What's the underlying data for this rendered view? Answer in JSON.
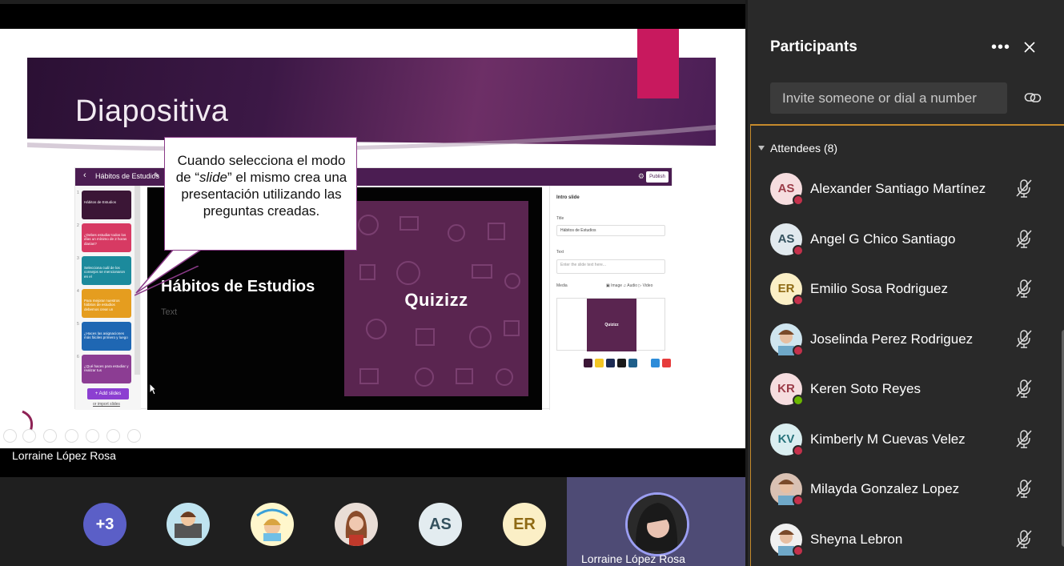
{
  "slide": {
    "title": "Diapositiva",
    "callout_parts": [
      "Cuando selecciona el modo de “",
      "slide",
      "” el mismo crea una presentación utilizando las preguntas creadas."
    ]
  },
  "editor": {
    "back": "‹",
    "title": "Hábitos de Estudios",
    "publish": "Publish",
    "thumbnails": [
      {
        "num": "1",
        "text": "Hábitos de Estudios",
        "color": "#3b1636"
      },
      {
        "num": "2",
        "text": "¿Debes estudiar todos los días un mínimo de 2 horas diarias?",
        "color": "#d73a63"
      },
      {
        "num": "3",
        "text": "Selecciona cuál de los consejos se mencionaron en el",
        "color": "#1c8a9c"
      },
      {
        "num": "4",
        "text": "Para mejorar nuestros hábitos de estudios debemos crear un",
        "color": "#e59d1f"
      },
      {
        "num": "5",
        "text": "¿Haces las asignaciones más fáciles primero y luego",
        "color": "#1f67b3"
      },
      {
        "num": "6",
        "text": "¿Qué haces para estudiar y realizar tus",
        "color": "#8c3d93"
      }
    ],
    "add_slides": "+ Add slides",
    "import_slides": "or import slides",
    "stage_title": "Hábitos de Estudios",
    "stage_text": "Text",
    "logo": "Quizizz",
    "right_panel": {
      "heading": "Intro slide",
      "title_label": "Title",
      "title_value": "Hábitos de Estudios",
      "text_label": "Text",
      "text_placeholder": "Enter the slide text here...",
      "media_label": "Media",
      "media_tabs": "▣ Image  ♫ Audio  ▷ Video",
      "media_logo": "Quizizz",
      "swatches": [
        "#3b1636",
        "#f3c624",
        "#1d2c54",
        "#1a1a1a",
        "#1f5f8a",
        "#ffffff",
        "#2d8cd9",
        "#e63c3c"
      ]
    }
  },
  "presenter": {
    "name": "Lorraine López Rosa"
  },
  "gallery": {
    "more": "+3",
    "initials_as": "AS",
    "initials_er": "ER",
    "speaker_name": "Lorraine López Rosa"
  },
  "panel": {
    "title": "Participants",
    "more": "•••",
    "invite_placeholder": "Invite someone or dial a number",
    "attendees_label": "Attendees (8)",
    "attendees": [
      {
        "name": "Alexander Santiago Martínez",
        "initials": "AS",
        "bg": "#f6dddf",
        "fg": "#9b3b47",
        "status": "busy"
      },
      {
        "name": "Angel G Chico Santiago",
        "initials": "AS",
        "bg": "#e1e9ee",
        "fg": "#34515e",
        "status": "busy"
      },
      {
        "name": "Emilio Sosa Rodriguez",
        "initials": "ER",
        "bg": "#fbefc6",
        "fg": "#8f6a14",
        "status": "busy"
      },
      {
        "name": "Joselinda Perez Rodriguez",
        "initials": "",
        "bg": "#cfe5ef",
        "fg": "#333333",
        "status": "busy"
      },
      {
        "name": "Keren Soto Reyes",
        "initials": "KR",
        "bg": "#f6dddf",
        "fg": "#9b3b47",
        "status": "available"
      },
      {
        "name": "Kimberly M Cuevas Velez",
        "initials": "KV",
        "bg": "#daeef0",
        "fg": "#27737b",
        "status": "busy"
      },
      {
        "name": "Milayda Gonzalez Lopez",
        "initials": "",
        "bg": "#d9c1b3",
        "fg": "#333333",
        "status": "busy"
      },
      {
        "name": "Sheyna Lebron",
        "initials": "",
        "bg": "#f0f0f0",
        "fg": "#333333",
        "status": "dnd"
      }
    ]
  }
}
